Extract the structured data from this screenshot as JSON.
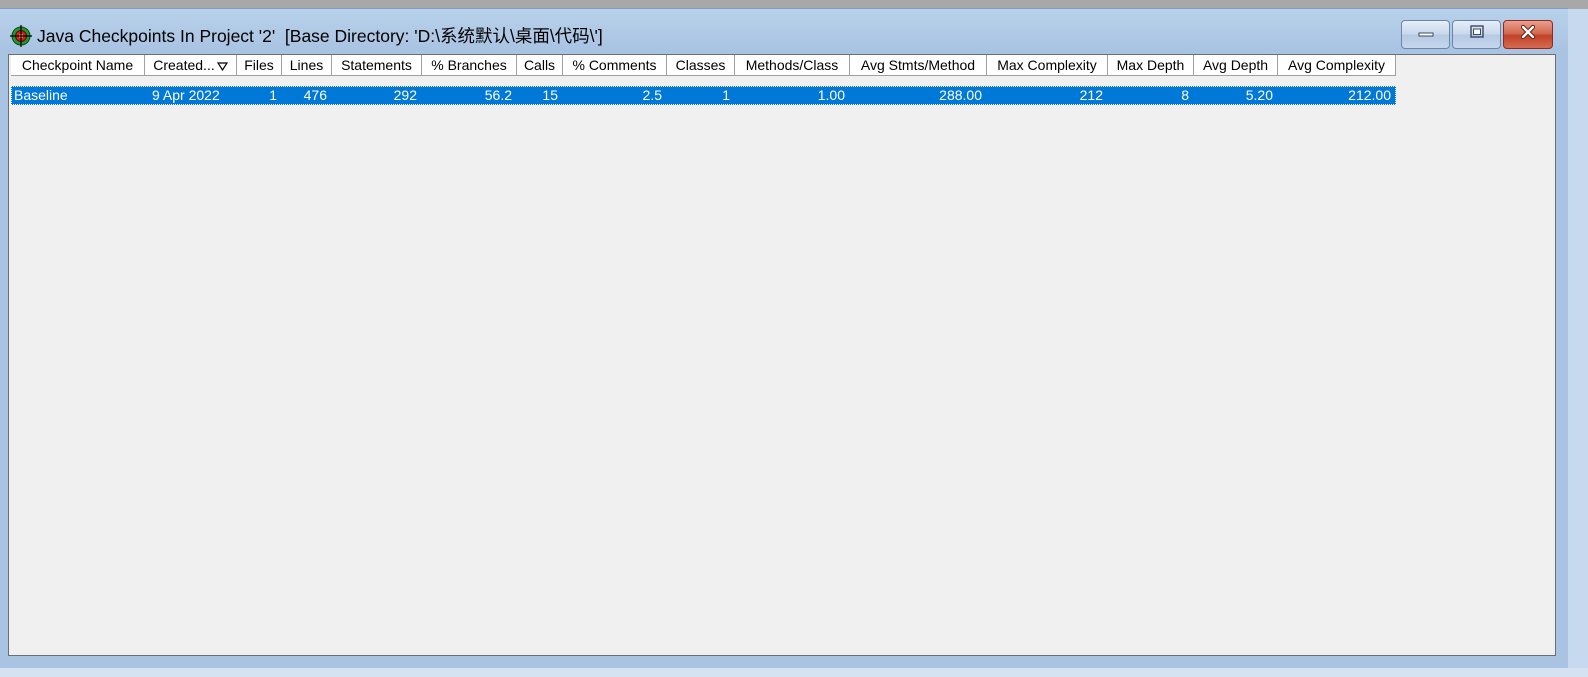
{
  "window": {
    "title": "Java Checkpoints In Project '2'  [Base Directory: 'D:\\系统默认\\桌面\\代码\\']",
    "icon": "target-crosshair-icon",
    "controls": {
      "minimize": "minimize-icon",
      "maximize": "maximize-icon",
      "close": "close-icon"
    }
  },
  "table": {
    "columns": [
      "Checkpoint Name",
      "Created...",
      "Files",
      "Lines",
      "Statements",
      "% Branches",
      "Calls",
      "% Comments",
      "Classes",
      "Methods/Class",
      "Avg Stmts/Method",
      "Max Complexity",
      "Max Depth",
      "Avg Depth",
      "Avg Complexity"
    ],
    "sort_column": "Created...",
    "rows": [
      [
        "Baseline",
        "9 Apr 2022",
        "1",
        "476",
        "292",
        "56.2",
        "15",
        "2.5",
        "1",
        "1.00",
        "288.00",
        "212",
        "8",
        "5.20",
        "212.00"
      ]
    ]
  },
  "colors": {
    "selection": "#0078d7",
    "client_bg": "#f0f0f0",
    "titlebar": "#b9d1ea",
    "close_button": "#c04228"
  }
}
